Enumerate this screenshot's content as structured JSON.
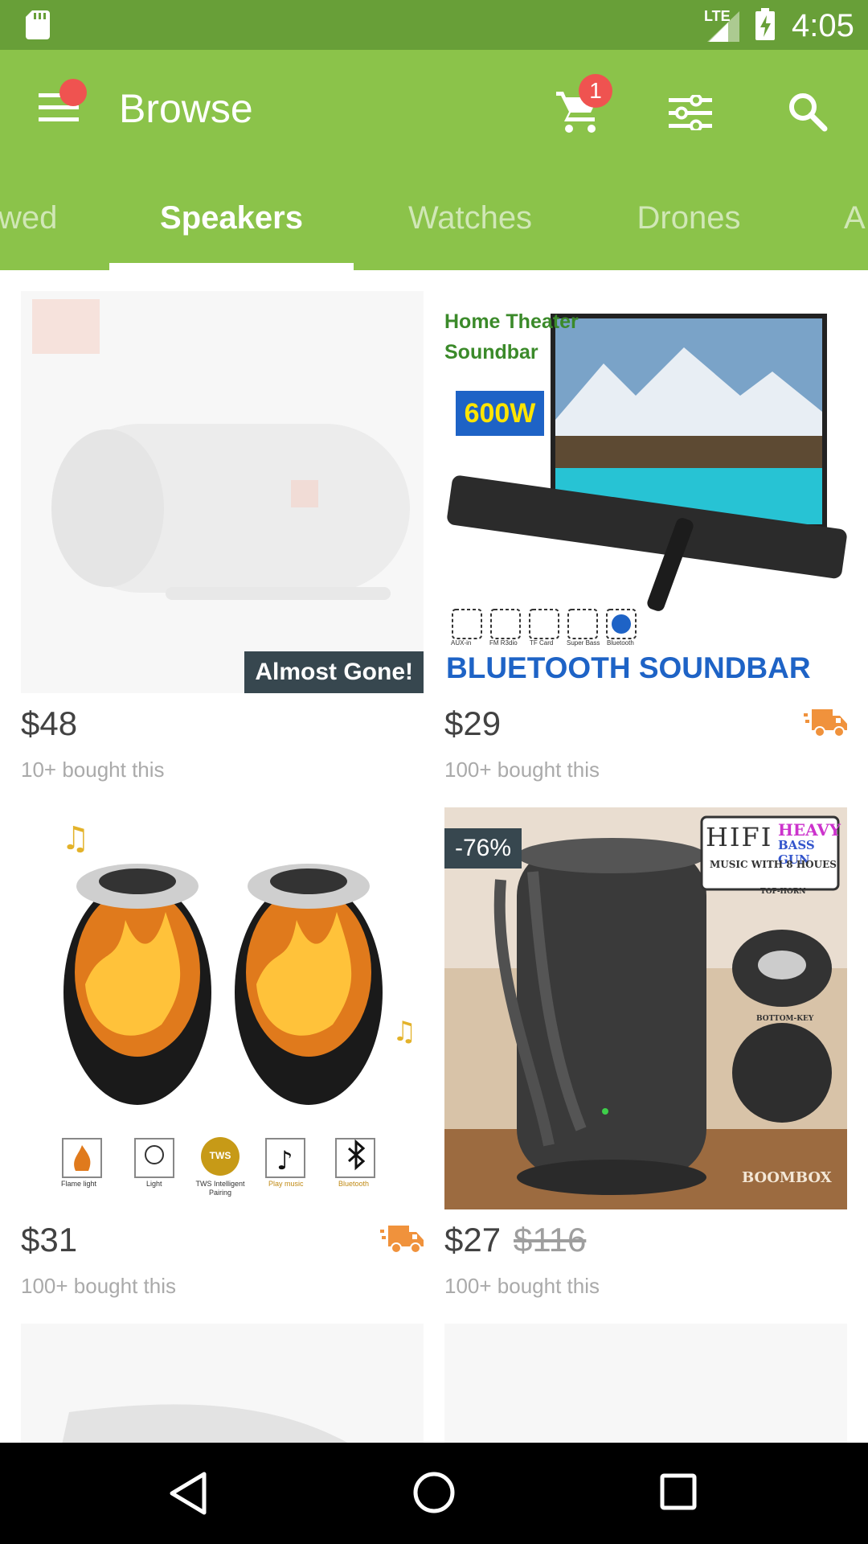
{
  "status_bar": {
    "time": "4:05",
    "network": "LTE",
    "icons": [
      "sd-card-icon",
      "signal-icon",
      "battery-charging-icon"
    ]
  },
  "toolbar": {
    "title": "Browse",
    "cart_count": "1",
    "icons": [
      "menu-icon",
      "cart-icon",
      "filter-icon",
      "search-icon"
    ]
  },
  "tabs": {
    "items": [
      "wed",
      "Speakers",
      "Watches",
      "Drones",
      "A"
    ],
    "active": "Speakers"
  },
  "products": [
    {
      "price": "$48",
      "bought": "10+ bought this",
      "badge": "Almost Gone!",
      "image": "jbl-portable-speaker"
    },
    {
      "price": "$29",
      "bought": "100+ bought this",
      "image": "home-theater-soundbar",
      "image_text": {
        "line1": "Home Theater",
        "line2": "Soundbar",
        "power": "600W",
        "banner": "BLUETOOTH SOUNDBAR",
        "features": [
          "AUX-in",
          "FM R3dio",
          "TF Card",
          "Super Bass",
          "Bluetooth"
        ]
      },
      "shipping_icon": "fast-shipping-icon"
    },
    {
      "price": "$31",
      "bought": "100+ bought this",
      "image": "flame-light-speakers",
      "image_text": {
        "features": [
          "Flame light",
          "Light",
          "TWS Intelligent Pairing",
          "Play music",
          "Bluetooth"
        ],
        "tws": "TWS"
      },
      "shipping_icon": "fast-shipping-icon"
    },
    {
      "price": "$27",
      "old_price": "$116",
      "bought": "100+ bought this",
      "discount": "-76%",
      "image": "boombox-speaker",
      "image_text": {
        "hifi": "HIFI",
        "heavy": "HEAVY",
        "bass_gun": "BASS GUN",
        "music": "MUSIC WITH 8 HOUES",
        "top": "TOP-HORN",
        "bottom": "BOTTOM-KEY",
        "boombox": "BOOMBOX"
      }
    }
  ],
  "nav": {
    "icons": [
      "back-icon",
      "home-icon",
      "recents-icon"
    ]
  },
  "colors": {
    "primary": "#8bc34a",
    "status_bar": "#689f38",
    "badge": "#37474f",
    "truck": "#f0923c",
    "cart_badge": "#ef5350"
  }
}
